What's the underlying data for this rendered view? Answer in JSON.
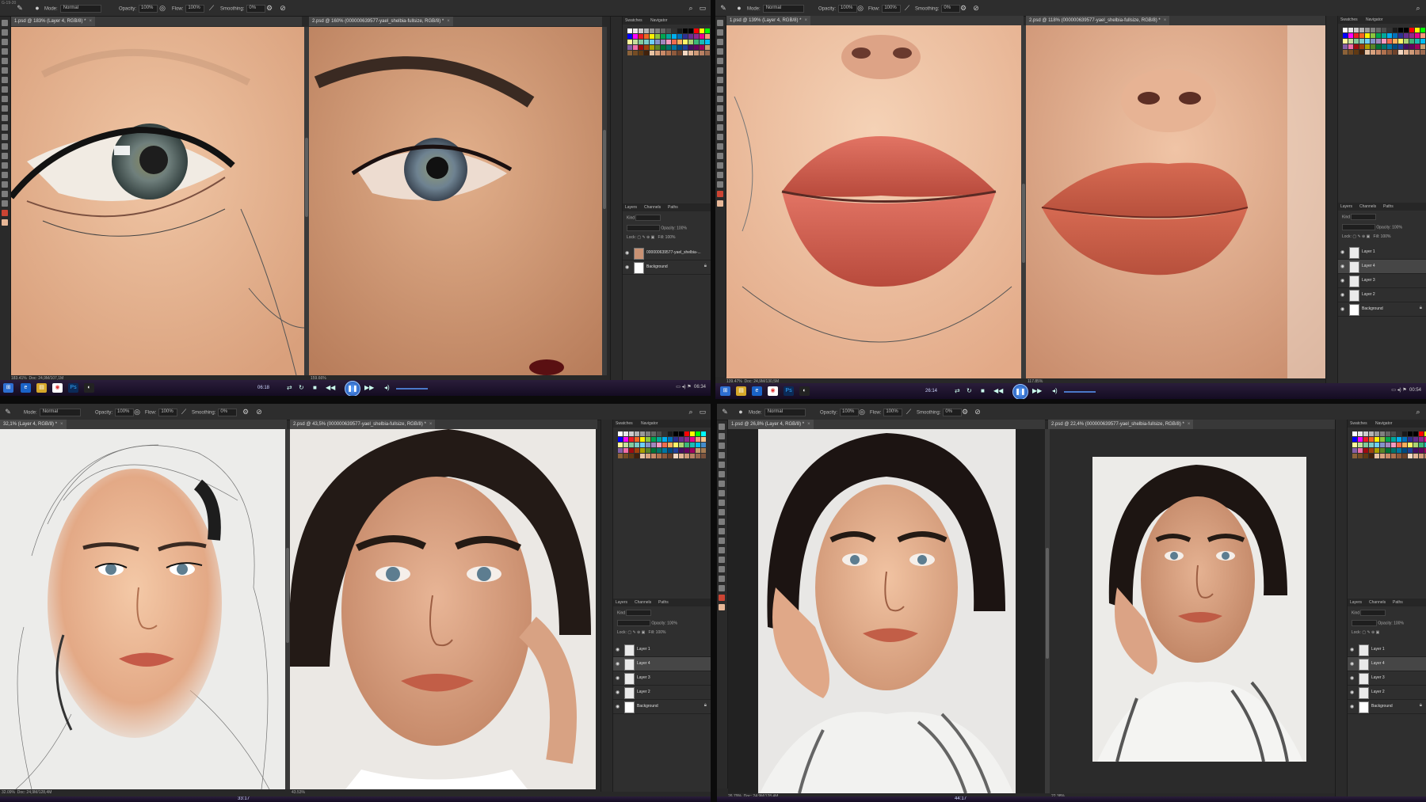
{
  "topbar_text": "G-19-20",
  "common": {
    "mode_label": "Mode:",
    "mode_value": "Normal",
    "opacity_label": "Opacity:",
    "opacity_value": "100%",
    "flow_label": "Flow:",
    "flow_value": "100%",
    "smoothing_label": "Smoothing:",
    "smoothing_value": "0%",
    "panel_tabs": [
      "Swatches",
      "Navigator"
    ],
    "layers_tabs": [
      "Layers",
      "Channels",
      "Paths"
    ],
    "kind_label": "Kind",
    "normal_label": "Normal",
    "opacity_small": "Opacity: 100%",
    "lock_label": "Lock:",
    "fill_label": "Fill: 100%"
  },
  "colors": {
    "ps_bg": "#282828",
    "ps_panel": "#2f2f2f",
    "taskbar": "#1c1330",
    "player_accent": "#3f86ff"
  },
  "swatch_colors": [
    "#ffffff",
    "#e6e6e6",
    "#cccccc",
    "#b3b3b3",
    "#999999",
    "#808080",
    "#666666",
    "#4d4d4d",
    "#333333",
    "#1a1a1a",
    "#000000",
    "#000000",
    "#ff0000",
    "#ffff00",
    "#00ff00",
    "#00ffff",
    "#0000ff",
    "#ff00ff",
    "#ed1c24",
    "#f26522",
    "#fff200",
    "#8dc63f",
    "#00a651",
    "#00a99d",
    "#00aeef",
    "#0072bc",
    "#2e3192",
    "#662d91",
    "#92278f",
    "#ec008c",
    "#f7977a",
    "#fdc68a",
    "#fff79a",
    "#c4df9b",
    "#82ca9c",
    "#7accc8",
    "#6dcff6",
    "#8393ca",
    "#a187be",
    "#f49ac1",
    "#f26c4f",
    "#fbaf5c",
    "#fff467",
    "#acd372",
    "#3cb878",
    "#1cbbb4",
    "#00bff3",
    "#448ccb",
    "#8560a8",
    "#f06eaa",
    "#9e0b0f",
    "#a0410d",
    "#aba000",
    "#598527",
    "#007236",
    "#00746b",
    "#0076a3",
    "#004a80",
    "#21409a",
    "#440e62",
    "#630460",
    "#9e005d",
    "#c69c6d",
    "#a67c52",
    "#8c6239",
    "#754c24",
    "#603913",
    "#42210b",
    "#e8c3a3",
    "#d9a27e",
    "#c98a68",
    "#b0724f",
    "#8f5a3c",
    "#6e422a",
    "#f3d7c2",
    "#e3b596",
    "#cf9a78",
    "#b98063",
    "#9b6a50",
    "#7a523d"
  ],
  "q1": {
    "tab1": "1.psd @ 183% (Layer 4, RGB/8) *",
    "tab2": "2.psd @ 160% (000000639577-yael_shelbia-fullsize, RGB/8) *",
    "status_left": "183.41%",
    "status_mid": "Doc: 24,9M/107,1M",
    "status_right": "159.66%",
    "time_left": "06:18",
    "time_right": "06:34",
    "layers": [
      {
        "name": "000000639577-yael_shelbia-...",
        "active": false,
        "locked": false
      },
      {
        "name": "Background",
        "active": false,
        "locked": true
      }
    ]
  },
  "q2": {
    "tab1": "1.psd @ 139% (Layer 4, RGB/8) *",
    "tab2": "2.psd @ 118% (000000639577-yael_shelbia-fullsize, RGB/8) *",
    "status_left": "139.47%",
    "status_mid": "Doc: 24,9M/130,5M",
    "status_right": "117.85%",
    "time_left": "26:14",
    "time_right": "00:54",
    "layers": [
      {
        "name": "Layer 1",
        "active": false,
        "locked": false
      },
      {
        "name": "Layer 4",
        "active": true,
        "locked": false
      },
      {
        "name": "Layer 3",
        "active": false,
        "locked": false
      },
      {
        "name": "Layer 2",
        "active": false,
        "locked": false
      },
      {
        "name": "Background",
        "active": false,
        "locked": true
      }
    ]
  },
  "q3": {
    "tab1": "32,1% (Layer 4, RGB/8) *",
    "tab2": "2.psd @ 43,5% (000000639577-yael_shelbia-fullsize, RGB/8) *",
    "status_left": "32.09%",
    "status_mid": "Doc: 24,9M/128,4M",
    "status_right": "43.53%",
    "time_left": "33:17",
    "layers": [
      {
        "name": "Layer 1",
        "active": false,
        "locked": false
      },
      {
        "name": "Layer 4",
        "active": true,
        "locked": false
      },
      {
        "name": "Layer 3",
        "active": false,
        "locked": false
      },
      {
        "name": "Layer 2",
        "active": false,
        "locked": false
      },
      {
        "name": "Background",
        "active": false,
        "locked": true
      }
    ]
  },
  "q4": {
    "tab1": "1.psd @ 26,8% (Layer 4, RGB/8) *",
    "tab2": "2.psd @ 22,4% (000000639577-yael_shelbia-fullsize, RGB/8) *",
    "status_left": "26.79%",
    "status_mid": "Doc: 24,9M/128,4M",
    "status_right": "22.38%",
    "time_left": "44:17",
    "layers": [
      {
        "name": "Layer 1",
        "active": false,
        "locked": false
      },
      {
        "name": "Layer 4",
        "active": true,
        "locked": false
      },
      {
        "name": "Layer 3",
        "active": false,
        "locked": false
      },
      {
        "name": "Layer 2",
        "active": false,
        "locked": false
      },
      {
        "name": "Background",
        "active": false,
        "locked": true
      }
    ]
  }
}
